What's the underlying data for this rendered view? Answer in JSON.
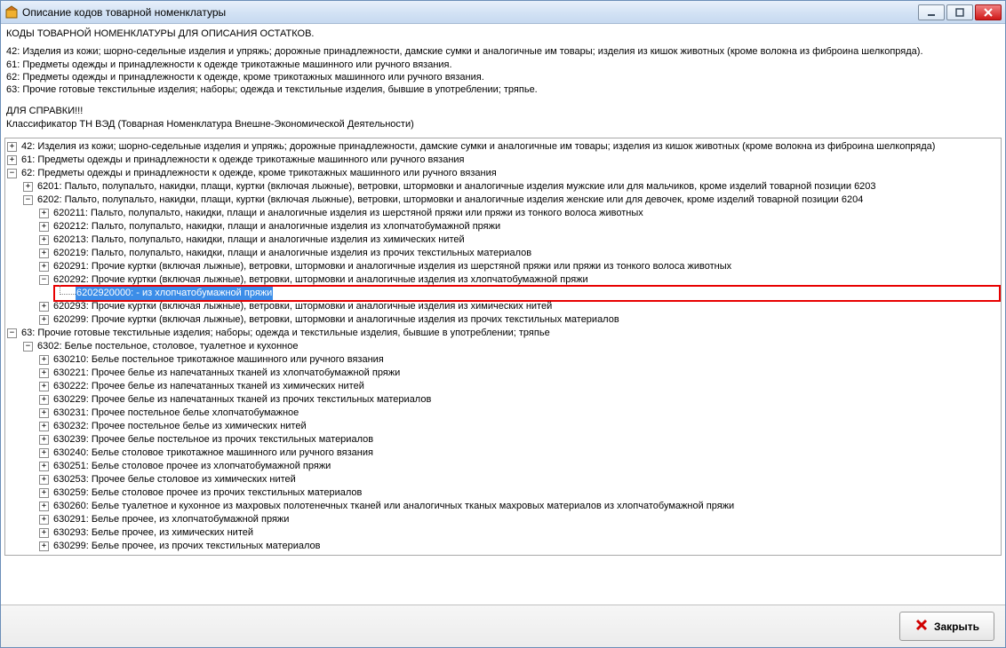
{
  "window": {
    "title": "Описание кодов товарной номенклатуры"
  },
  "info": {
    "heading": "КОДЫ ТОВАРНОЙ НОМЕНКЛАТУРЫ ДЛЯ ОПИСАНИЯ ОСТАТКОВ.",
    "line42": "42: Изделия из кожи; шорно-седельные изделия и упряжь; дорожные принадлежности, дамские сумки и аналогичные им товары; изделия из кишок животных (кроме волокна из фиброина шелкопряда).",
    "line61": "61: Предметы одежды и принадлежности к одежде трикотажные машинного или ручного вязания.",
    "line62": "62: Предметы одежды и принадлежности к одежде, кроме трикотажных машинного или ручного вязания.",
    "line63": "63: Прочие готовые текстильные изделия; наборы; одежда и текстильные изделия, бывшие в употреблении; тряпье.",
    "ref_title": "ДЛЯ СПРАВКИ!!!",
    "ref_text": "Классификатор ТН ВЭД (Товарная Номенклатура Внешне-Экономической Деятельности)"
  },
  "tree": {
    "n42": "42: Изделия из кожи; шорно-седельные изделия и упряжь; дорожные принадлежности, дамские сумки и аналогичные им товары; изделия из кишок животных (кроме волокна из фиброина шелкопряда)",
    "n61": "61: Предметы одежды и принадлежности к одежде трикотажные машинного или ручного вязания",
    "n62": "62: Предметы одежды и принадлежности к одежде, кроме трикотажных машинного или ручного вязания",
    "n6201": "6201: Пальто, полупальто, накидки, плащи, куртки (включая лыжные), ветровки, штормовки и аналогичные изделия мужские или для мальчиков, кроме изделий товарной позиции 6203",
    "n6202": "6202: Пальто, полупальто, накидки, плащи, куртки (включая лыжные), ветровки, штормовки и аналогичные изделия женские или для девочек, кроме изделий товарной позиции 6204",
    "n620211": "620211: Пальто, полупальто, накидки, плащи и аналогичные изделия из шерстяной пряжи или пряжи из тонкого волоса животных",
    "n620212": "620212: Пальто, полупальто, накидки, плащи и аналогичные изделия  из хлопчатобумажной пряжи",
    "n620213": "620213: Пальто, полупальто, накидки, плащи и аналогичные изделия  из химических нитей",
    "n620219": "620219: Пальто, полупальто, накидки, плащи и аналогичные изделия из прочих текстильных материалов",
    "n620291": "620291: Прочие куртки (включая лыжные), ветровки, штормовки и аналогичные изделия из шерстяной пряжи или пряжи из тонкого волоса животных",
    "n620292": "620292: Прочие куртки (включая лыжные), ветровки, штормовки и аналогичные изделия из хлопчатобумажной пряжи",
    "n6202920000": "6202920000: - из хлопчатобумажной пряжи",
    "n620293": "620293: Прочие куртки (включая лыжные), ветровки, штормовки и аналогичные изделия из химических нитей",
    "n620299": "620299: Прочие куртки (включая лыжные), ветровки, штормовки и аналогичные изделия из прочих текстильных материалов",
    "n63": "63: Прочие готовые текстильные изделия; наборы; одежда и текстильные изделия, бывшие в употреблении; тряпье",
    "n6302": "6302: Белье постельное, столовое, туалетное и кухонное",
    "n630210": "630210: Белье постельное трикотажное машинного или ручного вязания",
    "n630221": "630221: Прочее белье из напечатанных тканей из хлопчатобумажной пряжи",
    "n630222": "630222: Прочее белье из напечатанных тканей из химических нитей",
    "n630229": "630229: Прочее белье из напечатанных тканей из прочих текстильных материалов",
    "n630231": "630231: Прочее постельное белье хлопчатобумажное",
    "n630232": "630232: Прочее постельное белье из химических нитей",
    "n630239": "630239: Прочее белье постельное из прочих текстильных материалов",
    "n630240": "630240: Белье столовое трикотажное машинного или ручного вязания",
    "n630251": "630251: Белье столовое прочее из хлопчатобумажной пряжи",
    "n630253": "630253: Прочее белье столовое из химических нитей",
    "n630259": "630259: Белье столовое прочее из прочих текстильных материалов",
    "n630260": "630260: Белье туалетное и кухонное из махровых полотенечных тканей или аналогичных тканых махровых материалов из хлопчатобумажной пряжи",
    "n630291": "630291: Белье прочее, из хлопчатобумажной пряжи",
    "n630293": "630293: Белье прочее, из химических нитей",
    "n630299": "630299: Белье прочее, из прочих текстильных материалов"
  },
  "footer": {
    "close_label": "Закрыть"
  }
}
